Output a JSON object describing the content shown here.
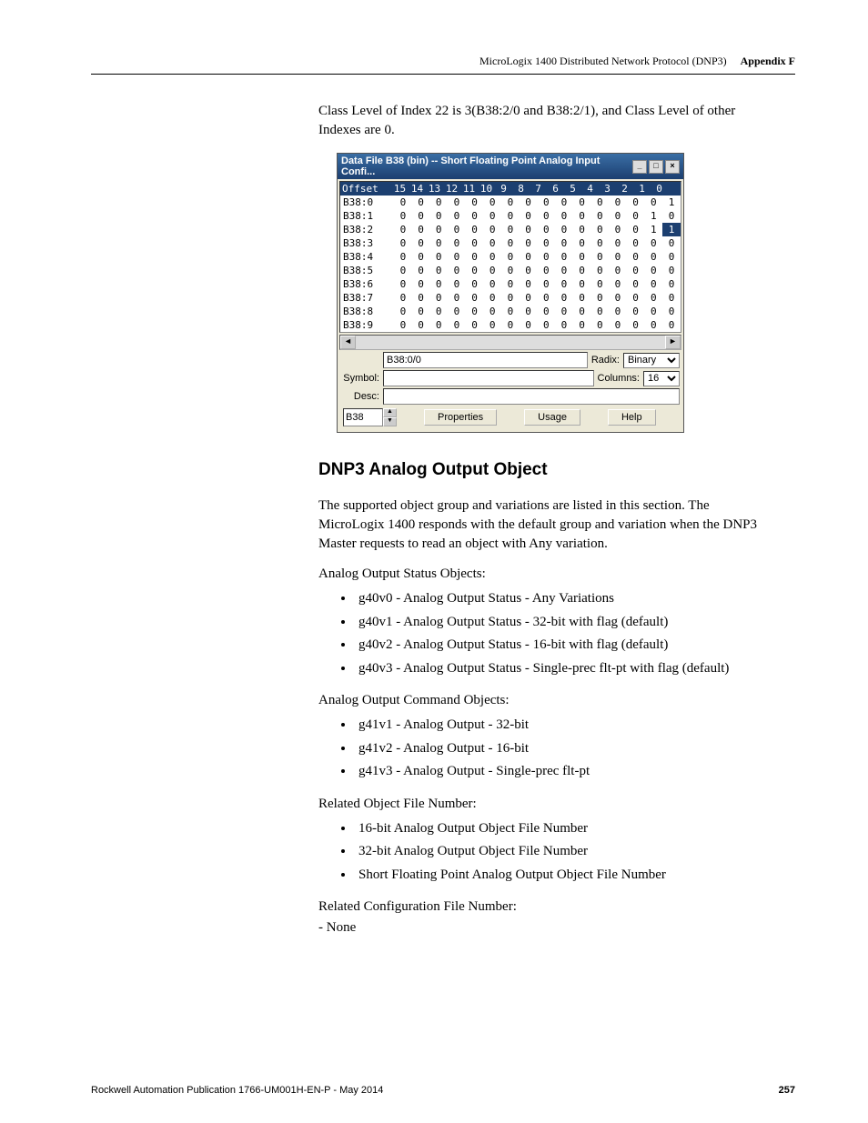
{
  "header": {
    "doc_title": "MicroLogix 1400 Distributed Network Protocol (DNP3)",
    "appendix": "Appendix F"
  },
  "intro_para": "Class Level of Index 22 is 3(B38:2/0 and B38:2/1), and Class Level of other Indexes are 0.",
  "window": {
    "title": "Data File B38 (bin) -- Short Floating Point Analog Input Confi...",
    "offset_header": "Offset",
    "bit_headers": [
      "15",
      "14",
      "13",
      "12",
      "11",
      "10",
      "9",
      "8",
      "7",
      "6",
      "5",
      "4",
      "3",
      "2",
      "1",
      "0"
    ],
    "rows": [
      {
        "label": "B38:0",
        "bits": [
          "0",
          "0",
          "0",
          "0",
          "0",
          "0",
          "0",
          "0",
          "0",
          "0",
          "0",
          "0",
          "0",
          "0",
          "0",
          "1"
        ]
      },
      {
        "label": "B38:1",
        "bits": [
          "0",
          "0",
          "0",
          "0",
          "0",
          "0",
          "0",
          "0",
          "0",
          "0",
          "0",
          "0",
          "0",
          "0",
          "1",
          "0"
        ]
      },
      {
        "label": "B38:2",
        "bits": [
          "0",
          "0",
          "0",
          "0",
          "0",
          "0",
          "0",
          "0",
          "0",
          "0",
          "0",
          "0",
          "0",
          "0",
          "1",
          "1"
        ],
        "hl": 15
      },
      {
        "label": "B38:3",
        "bits": [
          "0",
          "0",
          "0",
          "0",
          "0",
          "0",
          "0",
          "0",
          "0",
          "0",
          "0",
          "0",
          "0",
          "0",
          "0",
          "0"
        ]
      },
      {
        "label": "B38:4",
        "bits": [
          "0",
          "0",
          "0",
          "0",
          "0",
          "0",
          "0",
          "0",
          "0",
          "0",
          "0",
          "0",
          "0",
          "0",
          "0",
          "0"
        ]
      },
      {
        "label": "B38:5",
        "bits": [
          "0",
          "0",
          "0",
          "0",
          "0",
          "0",
          "0",
          "0",
          "0",
          "0",
          "0",
          "0",
          "0",
          "0",
          "0",
          "0"
        ]
      },
      {
        "label": "B38:6",
        "bits": [
          "0",
          "0",
          "0",
          "0",
          "0",
          "0",
          "0",
          "0",
          "0",
          "0",
          "0",
          "0",
          "0",
          "0",
          "0",
          "0"
        ]
      },
      {
        "label": "B38:7",
        "bits": [
          "0",
          "0",
          "0",
          "0",
          "0",
          "0",
          "0",
          "0",
          "0",
          "0",
          "0",
          "0",
          "0",
          "0",
          "0",
          "0"
        ]
      },
      {
        "label": "B38:8",
        "bits": [
          "0",
          "0",
          "0",
          "0",
          "0",
          "0",
          "0",
          "0",
          "0",
          "0",
          "0",
          "0",
          "0",
          "0",
          "0",
          "0"
        ]
      },
      {
        "label": "B38:9",
        "bits": [
          "0",
          "0",
          "0",
          "0",
          "0",
          "0",
          "0",
          "0",
          "0",
          "0",
          "0",
          "0",
          "0",
          "0",
          "0",
          "0"
        ]
      }
    ],
    "addr_field": "B38:0/0",
    "radix_label": "Radix:",
    "radix_value": "Binary",
    "symbol_label": "Symbol:",
    "symbol_value": "",
    "columns_label": "Columns:",
    "columns_value": "16",
    "desc_label": "Desc:",
    "desc_value": "",
    "file_spin": "B38",
    "btn_properties": "Properties",
    "btn_usage": "Usage",
    "btn_help": "Help"
  },
  "section_heading": "DNP3 Analog Output Object",
  "para2": "The supported object group and variations are listed in this section. The MicroLogix 1400 responds with the default group and variation when the DNP3 Master requests to read an object with Any variation.",
  "list1_intro": "Analog Output Status Objects:",
  "list1": [
    "g40v0 - Analog Output Status - Any Variations",
    "g40v1 - Analog Output Status - 32-bit with flag (default)",
    "g40v2 - Analog Output Status - 16-bit with flag (default)",
    "g40v3 - Analog Output Status - Single-prec flt-pt with flag (default)"
  ],
  "list2_intro": "Analog Output Command Objects:",
  "list2": [
    "g41v1 - Analog Output - 32-bit",
    "g41v2 - Analog Output - 16-bit",
    "g41v3 - Analog Output - Single-prec flt-pt"
  ],
  "list3_intro": "Related Object File Number:",
  "list3": [
    "16-bit Analog Output Object File Number",
    "32-bit Analog Output Object File Number",
    "Short Floating Point Analog Output Object File Number"
  ],
  "list4_intro": "Related Configuration File Number:",
  "list4_line": "- None",
  "footer": {
    "pub": "Rockwell Automation Publication 1766-UM001H-EN-P - May 2014",
    "page": "257"
  }
}
